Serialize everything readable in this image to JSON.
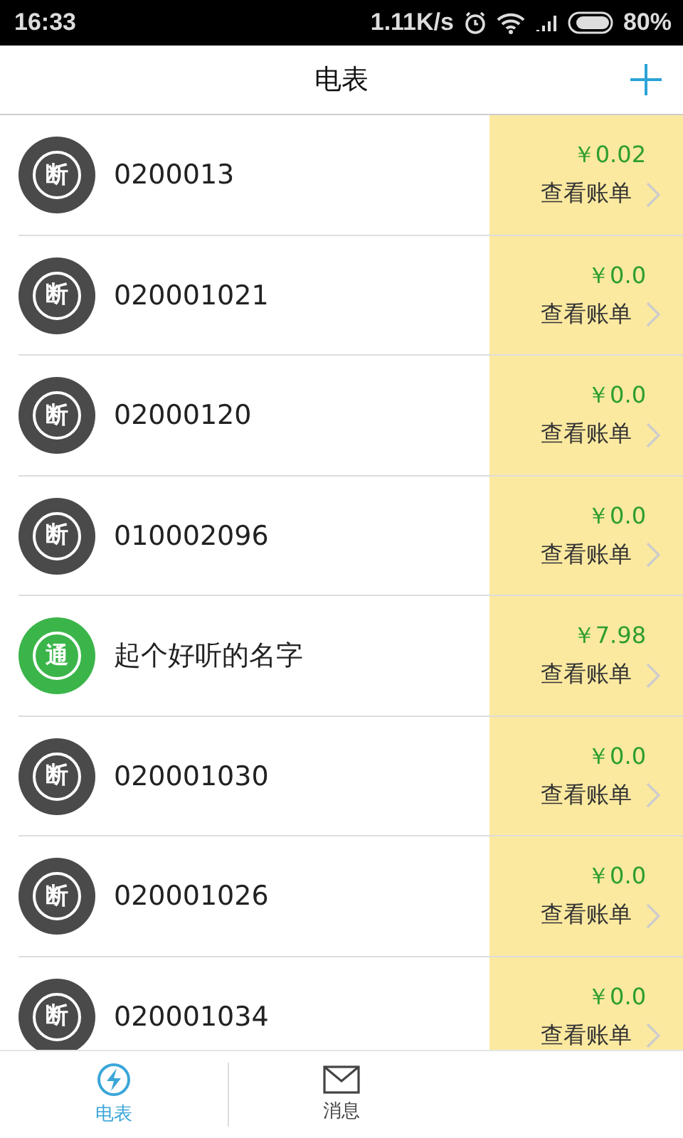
{
  "status_bar": {
    "time": "16:33",
    "speed": "1.11K/s",
    "battery": "80%"
  },
  "header": {
    "title": "电表"
  },
  "meters": [
    {
      "badge": "断",
      "connected": false,
      "name": "0200013",
      "amount": "￥0.02",
      "link": "查看账单"
    },
    {
      "badge": "断",
      "connected": false,
      "name": "020001021",
      "amount": "￥0.0",
      "link": "查看账单"
    },
    {
      "badge": "断",
      "connected": false,
      "name": "02000120",
      "amount": "￥0.0",
      "link": "查看账单"
    },
    {
      "badge": "断",
      "connected": false,
      "name": "010002096",
      "amount": "￥0.0",
      "link": "查看账单"
    },
    {
      "badge": "通",
      "connected": true,
      "name": "起个好听的名字",
      "amount": "￥7.98",
      "link": "查看账单"
    },
    {
      "badge": "断",
      "connected": false,
      "name": "020001030",
      "amount": "￥0.0",
      "link": "查看账单"
    },
    {
      "badge": "断",
      "connected": false,
      "name": "020001026",
      "amount": "￥0.0",
      "link": "查看账单"
    },
    {
      "badge": "断",
      "connected": false,
      "name": "020001034",
      "amount": "￥0.0",
      "link": "查看账单"
    }
  ],
  "tabs": [
    {
      "kind": "meter",
      "label": "电表",
      "selected": true
    },
    {
      "kind": "message",
      "label": "消息",
      "selected": false
    }
  ]
}
